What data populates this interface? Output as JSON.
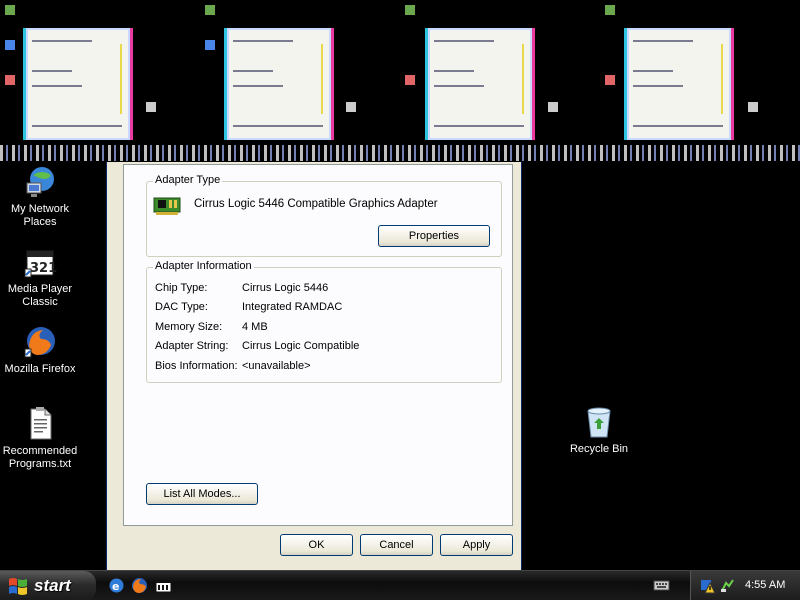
{
  "desktop": {
    "icons": [
      {
        "name": "My Network Places",
        "label": "My Network\nPlaces"
      },
      {
        "name": "Media Player Classic",
        "label": "Media Player\nClassic"
      },
      {
        "name": "Mozilla Firefox",
        "label": "Mozilla Firefox"
      },
      {
        "name": "Recommended Programs.txt",
        "label": "Recommended\nPrograms.txt"
      },
      {
        "name": "Recycle Bin",
        "label": "Recycle Bin"
      }
    ]
  },
  "dialog": {
    "adapter_type": {
      "title": "Adapter Type",
      "name": "Cirrus Logic 5446 Compatible Graphics Adapter",
      "properties_label": "Properties"
    },
    "adapter_info": {
      "title": "Adapter Information",
      "rows": [
        {
          "key": "Chip Type:",
          "value": "Cirrus Logic 5446"
        },
        {
          "key": "DAC Type:",
          "value": "Integrated RAMDAC"
        },
        {
          "key": "Memory Size:",
          "value": "4 MB"
        },
        {
          "key": "Adapter String:",
          "value": "Cirrus Logic Compatible"
        },
        {
          "key": "Bios Information:",
          "value": "<unavailable>"
        }
      ]
    },
    "list_modes_label": "List All Modes...",
    "ok_label": "OK",
    "cancel_label": "Cancel",
    "apply_label": "Apply"
  },
  "taskbar": {
    "start_label": "start",
    "clock": "4:55 AM"
  },
  "colors": {
    "accent": "#003c74",
    "dialog_bg": "#ece9d8",
    "desktop_bg": "#000000"
  }
}
